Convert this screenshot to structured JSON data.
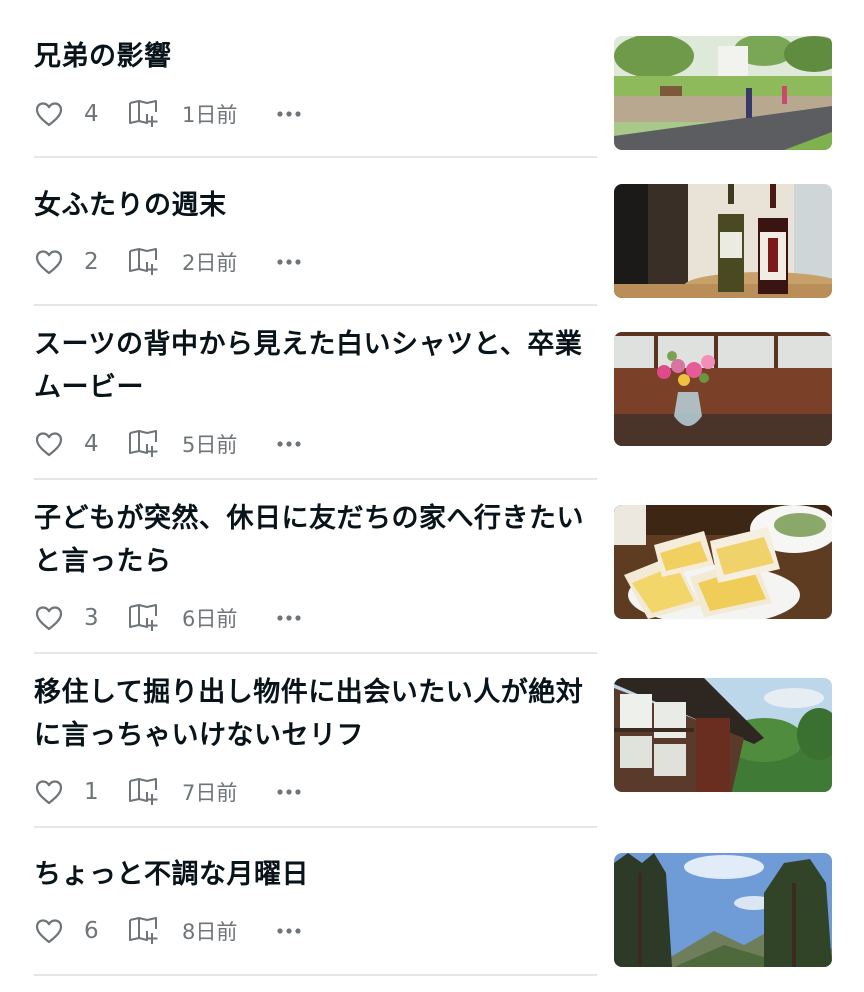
{
  "articles": [
    {
      "title": "兄弟の影響",
      "likes": "4",
      "date": "1日前",
      "thumbnail": "park-photo"
    },
    {
      "title": "女ふたりの週末",
      "likes": "2",
      "date": "2日前",
      "thumbnail": "sake-bottles-photo"
    },
    {
      "title": "スーツの背中から見えた白いシャツと、卒業ムービー",
      "likes": "4",
      "date": "5日前",
      "thumbnail": "flower-vase-photo"
    },
    {
      "title": "子どもが突然、休日に友だちの家へ行きたいと言ったら",
      "likes": "3",
      "date": "6日前",
      "thumbnail": "egg-sandwich-photo"
    },
    {
      "title": "移住して掘り出し物件に出会いたい人が絶対に言っちゃいけないセリフ",
      "likes": "1",
      "date": "7日前",
      "thumbnail": "old-house-photo"
    },
    {
      "title": "ちょっと不調な月曜日",
      "likes": "6",
      "date": "8日前",
      "thumbnail": "mountain-trees-photo"
    }
  ],
  "icons": {
    "like": "heart-outline-icon",
    "save": "magazine-add-icon",
    "more": "more-horizontal-icon"
  },
  "colors": {
    "text": "#08131a",
    "meta": "#6e7478",
    "divider": "#e6e6e6"
  }
}
